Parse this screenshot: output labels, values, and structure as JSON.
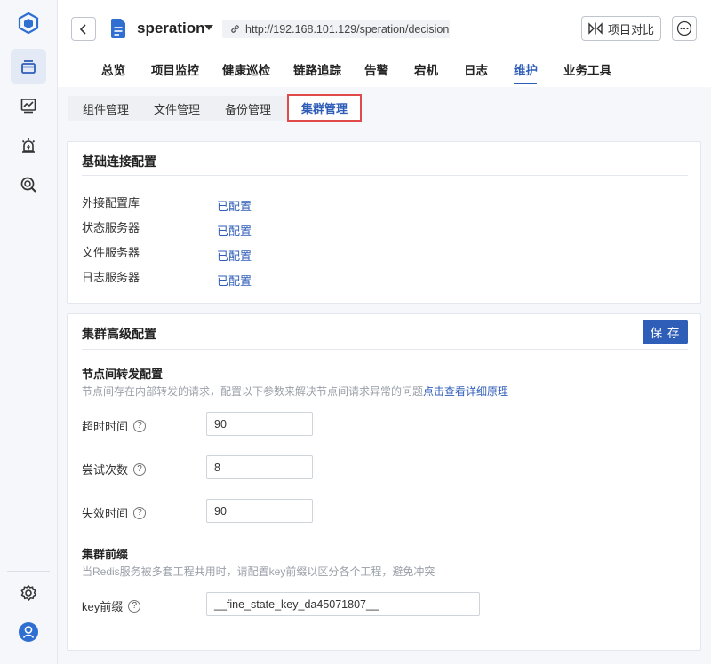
{
  "project": {
    "name": "speration",
    "url": "http://192.168.101.129/speration/decision"
  },
  "toolbar": {
    "compare_label": "项目对比"
  },
  "nav_tabs": [
    {
      "label": "总览"
    },
    {
      "label": "项目监控"
    },
    {
      "label": "健康巡检"
    },
    {
      "label": "链路追踪"
    },
    {
      "label": "告警"
    },
    {
      "label": "宕机"
    },
    {
      "label": "日志"
    },
    {
      "label": "维护",
      "active": true
    },
    {
      "label": "业务工具"
    }
  ],
  "sub_tabs": [
    {
      "label": "组件管理"
    },
    {
      "label": "文件管理"
    },
    {
      "label": "备份管理"
    },
    {
      "label": "集群管理",
      "active": true
    }
  ],
  "basic_config": {
    "title": "基础连接配置",
    "rows": [
      {
        "label": "外接配置库",
        "value": "已配置"
      },
      {
        "label": "状态服务器",
        "value": "已配置"
      },
      {
        "label": "文件服务器",
        "value": "已配置"
      },
      {
        "label": "日志服务器",
        "value": "已配置"
      }
    ]
  },
  "advanced_config": {
    "title": "集群高级配置",
    "save_label": "保 存",
    "forward": {
      "heading": "节点间转发配置",
      "desc": "节点间存在内部转发的请求，配置以下参数来解决节点间请求异常的问题",
      "link": "点击查看详细原理"
    },
    "fields": [
      {
        "label": "超时时间",
        "value": "90"
      },
      {
        "label": "尝试次数",
        "value": "8"
      },
      {
        "label": "失效时间",
        "value": "90"
      }
    ],
    "prefix": {
      "heading": "集群前缀",
      "desc": "当Redis服务被多套工程共用时，请配置key前缀以区分各个工程，避免冲突",
      "field_label": "key前缀",
      "field_value": "__fine_state_key_da45071807__"
    }
  },
  "help_glyph": "?",
  "colors": {
    "accent": "#2f5eb8",
    "highlight_border": "#e04a4a",
    "sidebar_bg": "#f5f7fa"
  },
  "icons": {
    "logo": "cube-logo-icon",
    "sidebar": [
      "layers-icon",
      "chart-icon",
      "alarm-icon",
      "search-tool-icon",
      "gear-icon",
      "user-avatar-icon"
    ],
    "back": "chevron-left-icon",
    "doc": "document-icon",
    "link": "link-icon",
    "compare": "compare-icon",
    "more": "more-icon"
  }
}
